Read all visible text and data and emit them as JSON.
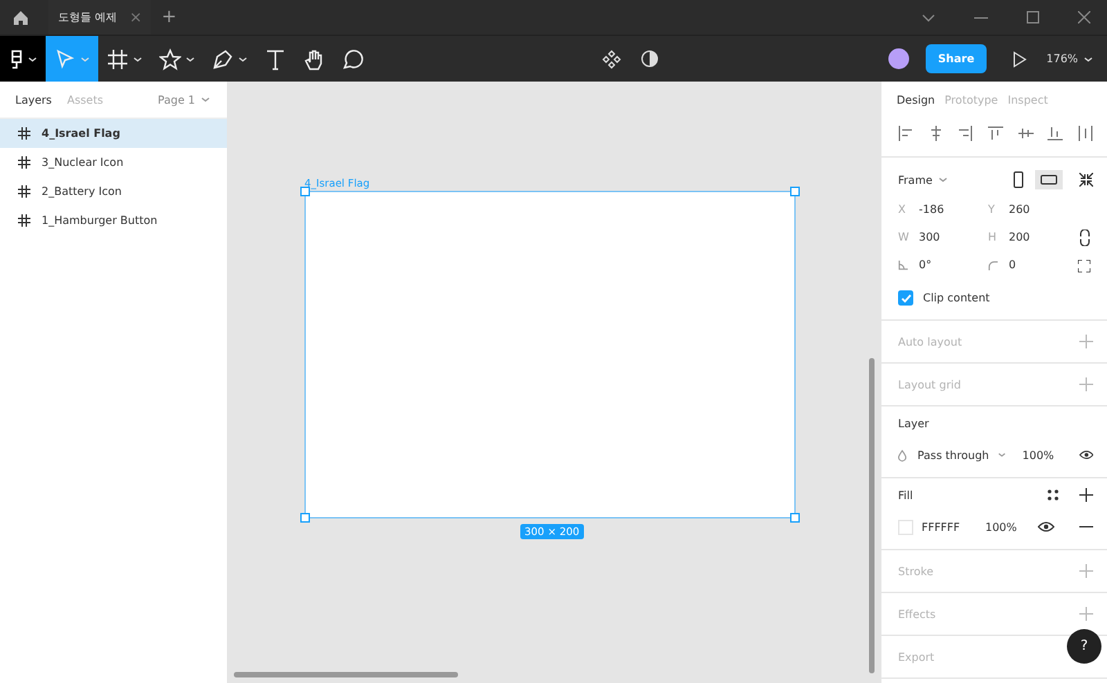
{
  "tab_bar": {
    "file_tab": "도형들 예제",
    "close": "×",
    "add": "+"
  },
  "toolbar": {
    "tools": [
      {
        "kind": "move",
        "selected": true
      },
      {
        "kind": "frame",
        "selected": false
      },
      {
        "kind": "shape",
        "selected": false
      },
      {
        "kind": "pen",
        "selected": false
      },
      {
        "kind": "text",
        "selected": false
      },
      {
        "kind": "hand",
        "selected": false
      },
      {
        "kind": "comment",
        "selected": false
      }
    ],
    "share": "Share",
    "zoom": "176%"
  },
  "left_panel": {
    "tabs": [
      {
        "label": "Layers",
        "selected": true
      },
      {
        "label": "Assets",
        "selected": false
      }
    ],
    "page": "Page 1",
    "layers": [
      {
        "name": "4_Israel Flag",
        "selected": true
      },
      {
        "name": "3_Nuclear Icon",
        "selected": false
      },
      {
        "name": "2_Battery Icon",
        "selected": false
      },
      {
        "name": "1_Hamburger Button",
        "selected": false
      }
    ]
  },
  "canvas": {
    "frame_label": "4_Israel Flag",
    "size": "300 × 200"
  },
  "right_panel": {
    "tabs": [
      {
        "label": "Design",
        "selected": true
      },
      {
        "label": "Prototype",
        "selected": false
      },
      {
        "label": "Inspect",
        "selected": false
      }
    ],
    "frame": {
      "title": "Frame",
      "fields": [
        {
          "label": "X",
          "value": "-186"
        },
        {
          "label": "Y",
          "value": "260"
        },
        {
          "label": "W",
          "value": "300"
        },
        {
          "label": "H",
          "value": "200"
        },
        {
          "kind": "rotation",
          "value": "0°"
        },
        {
          "kind": "radius",
          "value": "0"
        }
      ],
      "clip": {
        "label": "Clip content",
        "checked": true
      }
    },
    "sections": [
      {
        "kind": "empty",
        "title": "Auto layout"
      },
      {
        "kind": "empty",
        "title": "Layout grid"
      },
      {
        "kind": "layer",
        "title": "Layer",
        "mode": "Pass through",
        "opacity": "100%"
      },
      {
        "kind": "fill",
        "title": "Fill",
        "hex": "FFFFFF",
        "opacity": "100%"
      },
      {
        "kind": "empty",
        "title": "Stroke"
      },
      {
        "kind": "empty",
        "title": "Effects"
      },
      {
        "kind": "empty",
        "title": "Export"
      }
    ]
  },
  "help": "?"
}
